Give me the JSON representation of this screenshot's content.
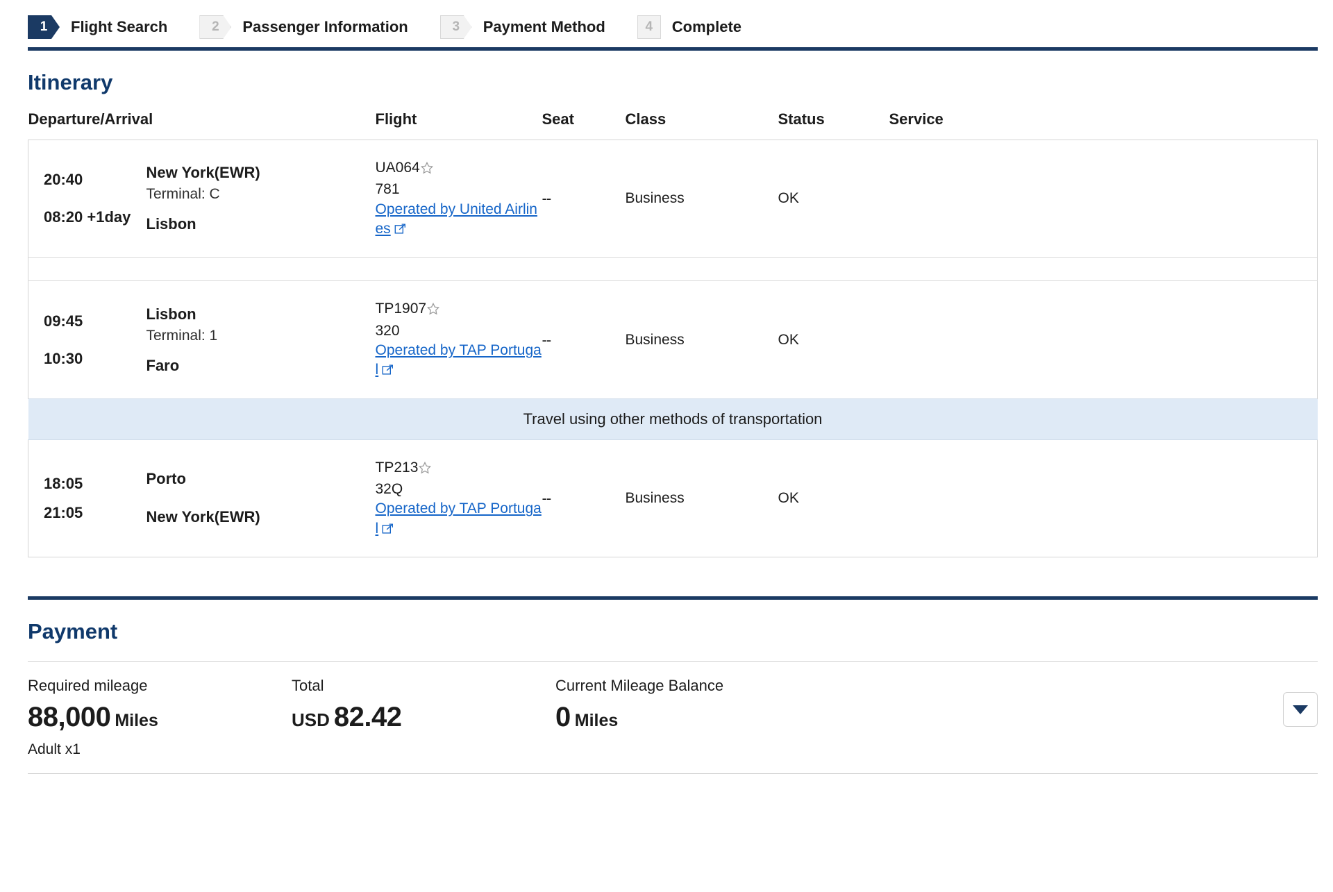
{
  "steps": [
    {
      "number": "1",
      "label": "Flight Search",
      "state": "active"
    },
    {
      "number": "2",
      "label": "Passenger Information",
      "state": "pending"
    },
    {
      "number": "3",
      "label": "Payment Method",
      "state": "pending"
    },
    {
      "number": "4",
      "label": "Complete",
      "state": "plain"
    }
  ],
  "itinerary": {
    "title": "Itinerary",
    "columns": {
      "departure_arrival": "Departure/Arrival",
      "flight": "Flight",
      "seat": "Seat",
      "class": "Class",
      "status": "Status",
      "service": "Service"
    },
    "banner": "Travel using other methods of transportation",
    "segments": [
      {
        "depart_time": "20:40",
        "depart_place": "New York(EWR)",
        "depart_terminal": "Terminal: C",
        "arrive_time": "08:20",
        "arrive_day_offset": "+1day",
        "arrive_place": "Lisbon",
        "flight_number": "UA064",
        "aircraft": "781",
        "operated_by": "Operated by United Airlines",
        "seat": "--",
        "class": "Business",
        "status": "OK",
        "service": ""
      },
      {
        "depart_time": "09:45",
        "depart_place": "Lisbon",
        "depart_terminal": "Terminal: 1",
        "arrive_time": "10:30",
        "arrive_day_offset": "",
        "arrive_place": "Faro",
        "flight_number": "TP1907",
        "aircraft": "320",
        "operated_by": "Operated by TAP Portugal",
        "seat": "--",
        "class": "Business",
        "status": "OK",
        "service": ""
      },
      {
        "depart_time": "18:05",
        "depart_place": "Porto",
        "depart_terminal": "",
        "arrive_time": "21:05",
        "arrive_day_offset": "",
        "arrive_place": "New York(EWR)",
        "flight_number": "TP213",
        "aircraft": "32Q",
        "operated_by": "Operated by TAP Portugal",
        "seat": "--",
        "class": "Business",
        "status": "OK",
        "service": ""
      }
    ]
  },
  "payment": {
    "title": "Payment",
    "required_mileage_label": "Required mileage",
    "required_mileage_value": "88,000",
    "required_mileage_unit": "Miles",
    "passengers": "Adult x1",
    "total_label": "Total",
    "total_currency": "USD",
    "total_value": "82.42",
    "balance_label": "Current Mileage Balance",
    "balance_value": "0",
    "balance_unit": "Miles"
  },
  "colors": {
    "navy": "#1b3a63",
    "heading_blue": "#10396b",
    "link_blue": "#1565c8",
    "banner_blue": "#dfeaf6"
  }
}
